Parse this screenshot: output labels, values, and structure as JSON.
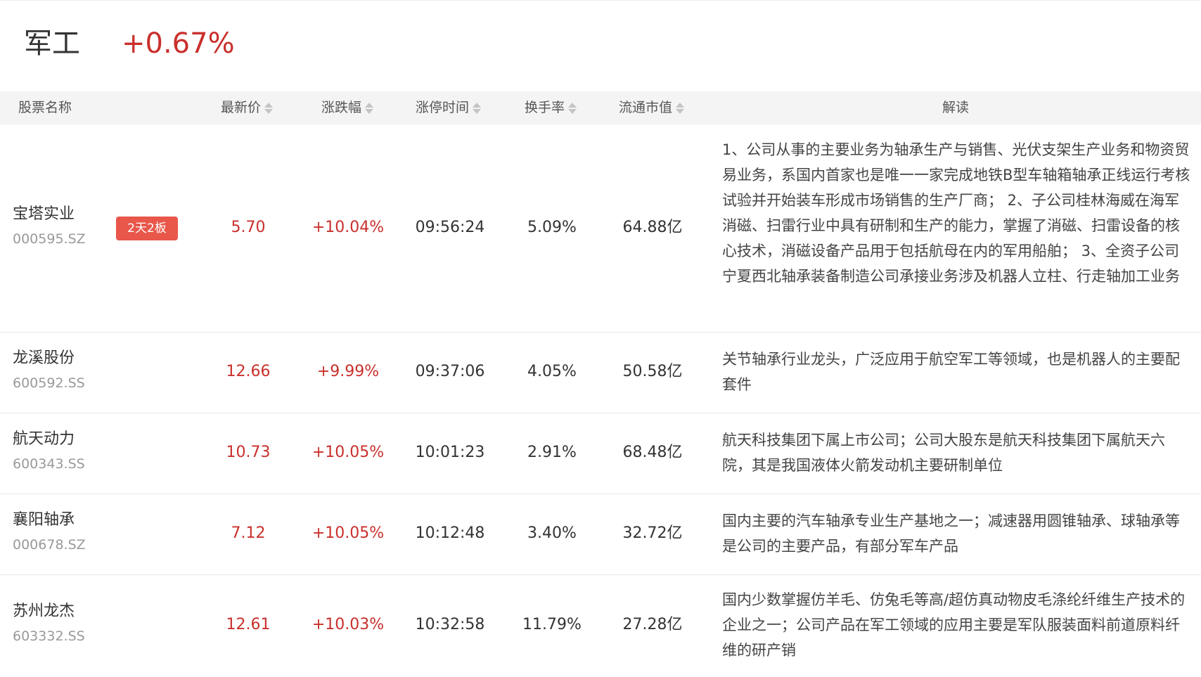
{
  "sector": {
    "name": "军工",
    "change": "+0.67%"
  },
  "columns": {
    "name": "股票名称",
    "price": "最新价",
    "change": "涨跌幅",
    "limit_time": "涨停时间",
    "turnover": "换手率",
    "market_cap": "流通市值",
    "description": "解读"
  },
  "colors": {
    "up": "#c9302c",
    "badge": "#e8574a",
    "header_bg": "#f4f4f4"
  },
  "rows": [
    {
      "name": "宝塔实业",
      "code": "000595.SZ",
      "badge": "2天2板",
      "price": "5.70",
      "change": "+10.04%",
      "limit_time": "09:56:24",
      "turnover": "5.09%",
      "market_cap": "64.88亿",
      "description": "1、公司从事的主要业务为轴承生产与销售、光伏支架生产业务和物资贸易业务，系国内首家也是唯一一家完成地铁B型车轴箱轴承正线运行考核试验并开始装车形成市场销售的生产厂商； 2、子公司桂林海威在海军消磁、扫雷行业中具有研制和生产的能力，掌握了消磁、扫雷设备的核心技术，消磁设备产品用于包括航母在内的军用船舶； 3、全资子公司宁夏西北轴承装备制造公司承接业务涉及机器人立柱、行走轴加工业务"
    },
    {
      "name": "龙溪股份",
      "code": "600592.SS",
      "badge": "",
      "price": "12.66",
      "change": "+9.99%",
      "limit_time": "09:37:06",
      "turnover": "4.05%",
      "market_cap": "50.58亿",
      "description": "关节轴承行业龙头，广泛应用于航空军工等领域，也是机器人的主要配套件"
    },
    {
      "name": "航天动力",
      "code": "600343.SS",
      "badge": "",
      "price": "10.73",
      "change": "+10.05%",
      "limit_time": "10:01:23",
      "turnover": "2.91%",
      "market_cap": "68.48亿",
      "description": "航天科技集团下属上市公司；公司大股东是航天科技集团下属航天六院，其是我国液体火箭发动机主要研制单位"
    },
    {
      "name": "襄阳轴承",
      "code": "000678.SZ",
      "badge": "",
      "price": "7.12",
      "change": "+10.05%",
      "limit_time": "10:12:48",
      "turnover": "3.40%",
      "market_cap": "32.72亿",
      "description": "国内主要的汽车轴承专业生产基地之一；减速器用圆锥轴承、球轴承等是公司的主要产品，有部分军车产品"
    },
    {
      "name": "苏州龙杰",
      "code": "603332.SS",
      "badge": "",
      "price": "12.61",
      "change": "+10.03%",
      "limit_time": "10:32:58",
      "turnover": "11.79%",
      "market_cap": "27.28亿",
      "description": "国内少数掌握仿羊毛、仿兔毛等高/超仿真动物皮毛涤纶纤维生产技术的企业之一；公司产品在军工领域的应用主要是军队服装面料前道原料纤维的研产销"
    }
  ]
}
